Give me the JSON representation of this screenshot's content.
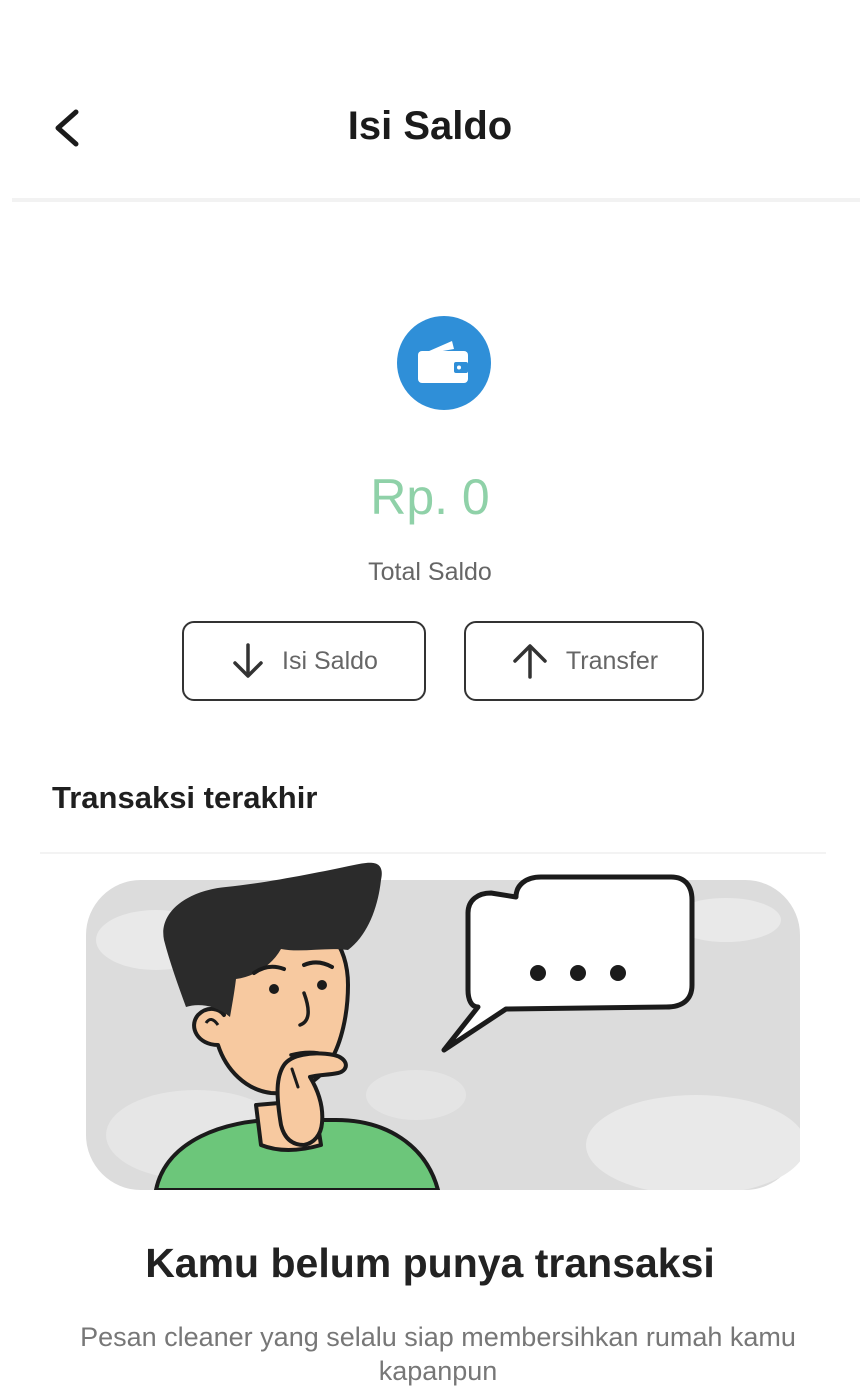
{
  "header": {
    "title": "Isi Saldo"
  },
  "wallet": {
    "balance": "Rp. 0",
    "balance_label": "Total Saldo"
  },
  "actions": {
    "topup_label": "Isi Saldo",
    "transfer_label": "Transfer"
  },
  "transactions": {
    "section_title": "Transaksi terakhir",
    "empty_title": "Kamu belum punya transaksi",
    "empty_description": "Pesan cleaner yang selalu siap membersihkan rumah kamu kapanpun"
  },
  "colors": {
    "accent_blue": "#2f8fd8",
    "balance_green": "#8fd1a8",
    "shirt_green": "#6cc67a",
    "skin": "#f7c9a0",
    "hair": "#2b2b2b",
    "illustration_bg": "#dcdcdc"
  },
  "icons": [
    "back-arrow-icon",
    "wallet-icon",
    "arrow-down-icon",
    "arrow-up-icon",
    "thinking-person-illustration",
    "speech-bubble-icon"
  ]
}
